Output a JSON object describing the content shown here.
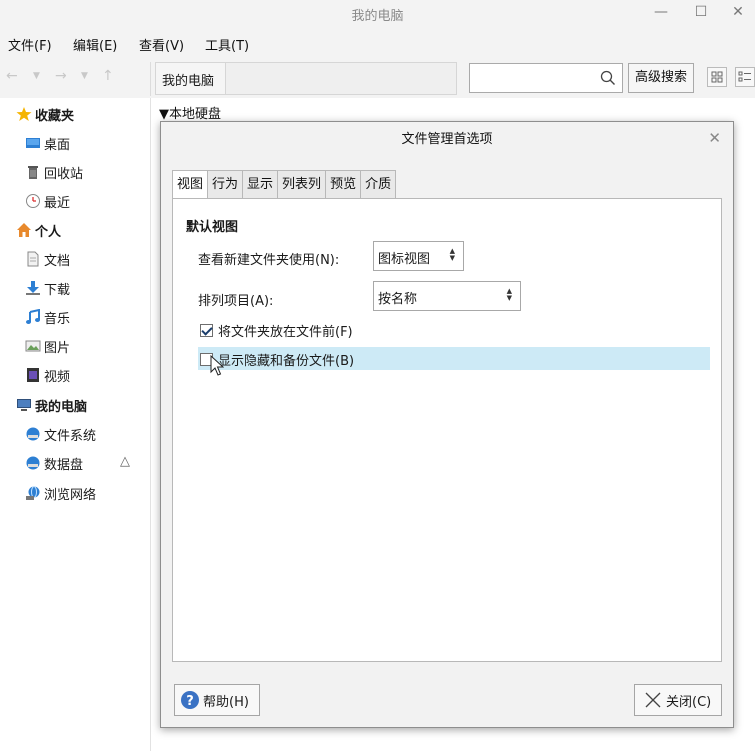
{
  "window": {
    "title": "我的电脑",
    "minimize_glyph": "—",
    "maximize_glyph": "☐",
    "close_glyph": "✕"
  },
  "menu": [
    "文件(F)",
    "编辑(E)",
    "查看(V)",
    "工具(T)"
  ],
  "toolbar": {
    "breadcrumb": "我的电脑",
    "search_value": "",
    "advanced_search_label": "高级搜索",
    "icons": [
      "back-arrow-icon",
      "forward-arrow-icon",
      "up-arrow-icon",
      "search-icon",
      "icon-view-icon",
      "list-view-icon"
    ]
  },
  "sidebar": {
    "favorites": {
      "label": "收藏夹",
      "icon": "star-icon"
    },
    "favorites_items": [
      {
        "label": "桌面",
        "icon": "desktop-icon"
      },
      {
        "label": "回收站",
        "icon": "trash-icon"
      },
      {
        "label": "最近",
        "icon": "clock-icon"
      }
    ],
    "personal": {
      "label": "个人",
      "icon": "home-icon"
    },
    "personal_items": [
      {
        "label": "文档",
        "icon": "document-icon"
      },
      {
        "label": "下载",
        "icon": "download-icon"
      },
      {
        "label": "音乐",
        "icon": "music-icon"
      },
      {
        "label": "图片",
        "icon": "picture-icon"
      },
      {
        "label": "视频",
        "icon": "video-icon"
      }
    ],
    "computer": {
      "label": "我的电脑",
      "icon": "computer-icon"
    },
    "computer_items": [
      {
        "label": "文件系统",
        "icon": "drive-icon"
      },
      {
        "label": "数据盘",
        "icon": "drive-icon"
      },
      {
        "label": "浏览网络",
        "icon": "network-icon"
      }
    ],
    "eject_glyph": "△"
  },
  "content": {
    "section_header": "▼本地硬盘"
  },
  "dialog": {
    "title": "文件管理首选项",
    "close_glyph": "✕",
    "tabs": [
      "视图",
      "行为",
      "显示",
      "列表列",
      "预览",
      "介质"
    ],
    "active_tab": "视图",
    "section_title": "默认视图",
    "new_folder_view_label": "查看新建文件夹使用(N):",
    "new_folder_view_value": "图标视图",
    "sort_label": "排列项目(A):",
    "sort_value": "按名称",
    "folders_first_label": "将文件夹放在文件前(F)",
    "folders_first_checked": true,
    "show_hidden_label": "显示隐藏和备份文件(B)",
    "show_hidden_checked": false,
    "help_label": "帮助(H)",
    "close_label": "关闭(C)"
  },
  "colors": {
    "highlight": "#cdeaf6",
    "accent_blue": "#2d7fd3",
    "star": "#f5b400"
  }
}
